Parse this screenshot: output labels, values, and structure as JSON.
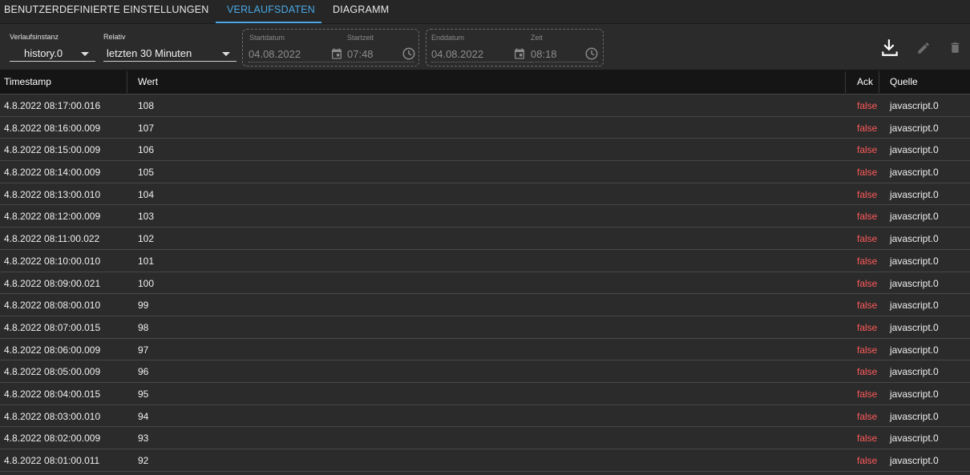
{
  "tabs": [
    {
      "label": "BENUTZERDEFINIERTE EINSTELLUNGEN"
    },
    {
      "label": "VERLAUFSDATEN"
    },
    {
      "label": "DIAGRAMM"
    }
  ],
  "toolbar": {
    "instance_label": "Verlaufsinstanz",
    "instance_value": "history.0",
    "relative_label": "Relativ",
    "relative_value": "letzten 30 Minuten",
    "start_date_label": "Startdatum",
    "start_date_value": "04.08.2022",
    "start_time_label": "Startzeit",
    "start_time_value": "07:48",
    "end_date_label": "Enddatum",
    "end_date_value": "04.08.2022",
    "end_time_label": "Zeit",
    "end_time_value": "08:18",
    "icons": [
      "download-icon",
      "pencil-icon",
      "trash-icon"
    ]
  },
  "table": {
    "columns": [
      "Timestamp",
      "Wert",
      "Ack",
      "Quelle"
    ],
    "rows": [
      {
        "ts": "4.8.2022 08:17:00.016",
        "val": "108",
        "ack": "false",
        "src": "javascript.0"
      },
      {
        "ts": "4.8.2022 08:16:00.009",
        "val": "107",
        "ack": "false",
        "src": "javascript.0"
      },
      {
        "ts": "4.8.2022 08:15:00.009",
        "val": "106",
        "ack": "false",
        "src": "javascript.0"
      },
      {
        "ts": "4.8.2022 08:14:00.009",
        "val": "105",
        "ack": "false",
        "src": "javascript.0"
      },
      {
        "ts": "4.8.2022 08:13:00.010",
        "val": "104",
        "ack": "false",
        "src": "javascript.0"
      },
      {
        "ts": "4.8.2022 08:12:00.009",
        "val": "103",
        "ack": "false",
        "src": "javascript.0"
      },
      {
        "ts": "4.8.2022 08:11:00.022",
        "val": "102",
        "ack": "false",
        "src": "javascript.0"
      },
      {
        "ts": "4.8.2022 08:10:00.010",
        "val": "101",
        "ack": "false",
        "src": "javascript.0"
      },
      {
        "ts": "4.8.2022 08:09:00.021",
        "val": "100",
        "ack": "false",
        "src": "javascript.0"
      },
      {
        "ts": "4.8.2022 08:08:00.010",
        "val": "99",
        "ack": "false",
        "src": "javascript.0"
      },
      {
        "ts": "4.8.2022 08:07:00.015",
        "val": "98",
        "ack": "false",
        "src": "javascript.0"
      },
      {
        "ts": "4.8.2022 08:06:00.009",
        "val": "97",
        "ack": "false",
        "src": "javascript.0"
      },
      {
        "ts": "4.8.2022 08:05:00.009",
        "val": "96",
        "ack": "false",
        "src": "javascript.0"
      },
      {
        "ts": "4.8.2022 08:04:00.015",
        "val": "95",
        "ack": "false",
        "src": "javascript.0"
      },
      {
        "ts": "4.8.2022 08:03:00.010",
        "val": "94",
        "ack": "false",
        "src": "javascript.0"
      },
      {
        "ts": "4.8.2022 08:02:00.009",
        "val": "93",
        "ack": "false",
        "src": "javascript.0"
      },
      {
        "ts": "4.8.2022 08:01:00.011",
        "val": "92",
        "ack": "false",
        "src": "javascript.0"
      }
    ]
  },
  "colors": {
    "accent": "#4aa8e6",
    "ack_false": "#ff5a5a",
    "background": "#2b2b2b",
    "header_bg": "#151515"
  }
}
